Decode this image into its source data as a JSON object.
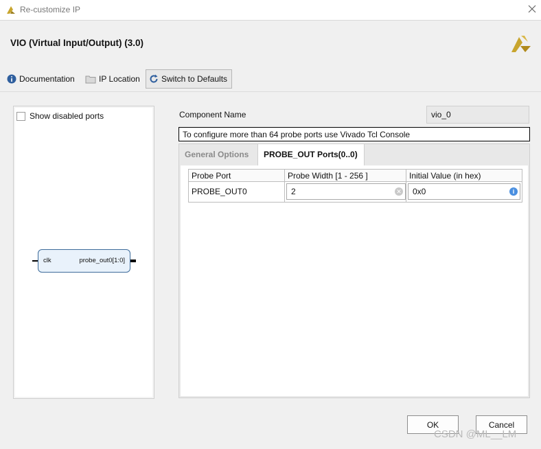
{
  "window": {
    "title": "Re-customize IP",
    "close_icon": "close-icon"
  },
  "ip": {
    "name": "VIO (Virtual Input/Output) (3.0)",
    "logo_icon": "xilinx-logo-icon"
  },
  "toolbar": {
    "documentation": "Documentation",
    "ip_location": "IP Location",
    "switch_defaults": "Switch to Defaults"
  },
  "symbol_panel": {
    "show_disabled_ports": "Show disabled ports",
    "block": {
      "left_port": "clk",
      "right_port": "probe_out0[1:0]"
    }
  },
  "component": {
    "label": "Component Name",
    "value": "vio_0"
  },
  "banner": "To configure more than 64 probe ports use Vivado Tcl Console",
  "tabs": [
    {
      "label": "General Options",
      "active": false
    },
    {
      "label": "PROBE_OUT Ports(0..0)",
      "active": true
    }
  ],
  "table": {
    "headers": [
      "Probe Port",
      "Probe Width [1 - 256 ]",
      "Initial Value (in hex)"
    ],
    "rows": [
      {
        "port": "PROBE_OUT0",
        "width": "2",
        "init": "0x0"
      }
    ]
  },
  "buttons": {
    "ok": "OK",
    "cancel": "Cancel"
  },
  "watermark": "CSDN @ML__LM",
  "colors": {
    "accent": "#3d6b9a",
    "brand": "#c8a52e",
    "info": "#4a8fe0"
  }
}
